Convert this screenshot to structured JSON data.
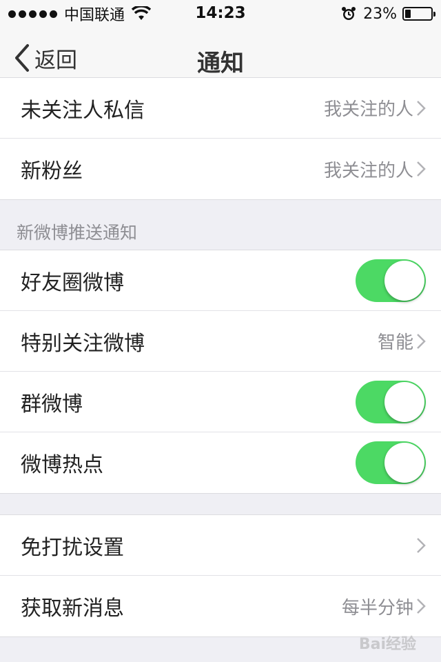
{
  "status_bar": {
    "carrier": "中国联通",
    "time": "14:23",
    "battery_percent": "23%",
    "battery_level": 0.23,
    "icons": [
      "signal-dots",
      "wifi-icon",
      "alarm-icon",
      "battery-icon"
    ]
  },
  "nav": {
    "back_label": "返回",
    "title": "通知"
  },
  "group1": [
    {
      "label": "未关注人私信",
      "value": "我关注的人"
    },
    {
      "label": "新粉丝",
      "value": "我关注的人"
    }
  ],
  "section_push": "新微博推送通知",
  "group2": [
    {
      "label": "好友圈微博",
      "toggle": true
    },
    {
      "label": "特别关注微博",
      "value": "智能"
    },
    {
      "label": "群微博",
      "toggle": true
    },
    {
      "label": "微博热点",
      "toggle": true
    }
  ],
  "group3": [
    {
      "label": "免打扰设置",
      "value": ""
    },
    {
      "label": "获取新消息",
      "value": "每半分钟"
    }
  ],
  "colors": {
    "toggle_on": "#4cd964",
    "background": "#efeff4",
    "secondary_text": "#8e8e93"
  },
  "watermark": "Bai经验"
}
